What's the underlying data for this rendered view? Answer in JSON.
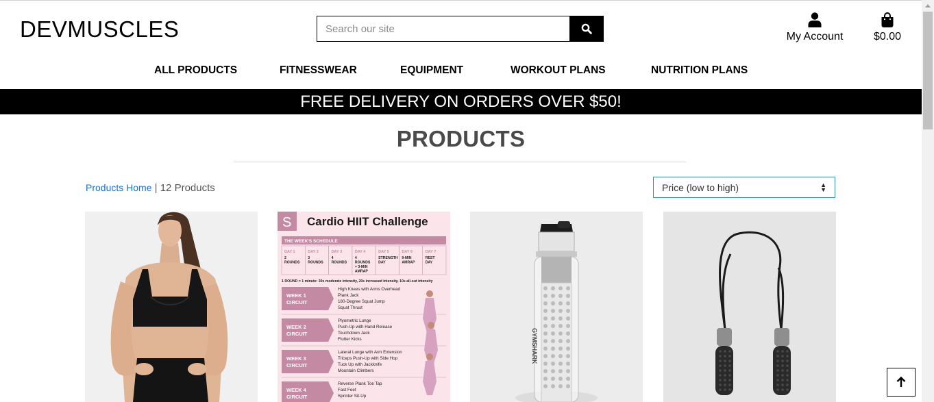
{
  "brand": {
    "logo": "DEVMUSCLES"
  },
  "search": {
    "placeholder": "Search our site",
    "value": "",
    "icon": "search-icon"
  },
  "account": {
    "label": "My Account",
    "icon": "user-icon"
  },
  "cart": {
    "total": "$0.00",
    "icon": "shopping-bag-icon"
  },
  "nav": {
    "items": [
      {
        "label": "ALL PRODUCTS"
      },
      {
        "label": "FITNESSWEAR"
      },
      {
        "label": "EQUIPMENT"
      },
      {
        "label": "WORKOUT PLANS"
      },
      {
        "label": "NUTRITION PLANS"
      }
    ]
  },
  "banner": {
    "text": "FREE DELIVERY ON ORDERS OVER $50!"
  },
  "page": {
    "title": "PRODUCTS"
  },
  "breadcrumb": {
    "home": "Products Home",
    "separator": " | ",
    "count": "12 Products"
  },
  "sort": {
    "selected": "Price (low to high)"
  },
  "products": [
    {
      "image": "black-sports-bra-photo"
    },
    {
      "image": "cardio-hiit-challenge-poster",
      "poster": {
        "badge": "S",
        "title": "Cardio HIIT Challenge",
        "schedule_label": "THE WEEK'S SCHEDULE",
        "days": [
          {
            "day": "DAY 1",
            "text": [
              "2",
              "ROUNDS"
            ]
          },
          {
            "day": "DAY 2",
            "text": [
              "3",
              "ROUNDS"
            ]
          },
          {
            "day": "DAY 3",
            "text": [
              "4",
              "ROUNDS"
            ]
          },
          {
            "day": "DAY 4",
            "text": [
              "4",
              "ROUNDS",
              "+ 3-MIN",
              "AMRAP"
            ]
          },
          {
            "day": "DAY 5",
            "text": [
              "STRENGTH",
              "DAY"
            ]
          },
          {
            "day": "DAY 6",
            "text": [
              "9-MIN",
              "AMRAP"
            ]
          },
          {
            "day": "DAY 7",
            "text": [
              "REST",
              "DAY"
            ]
          }
        ],
        "round_note": "1 ROUND = 1 minute: 30s moderate intensity, 20s increased intensity, 10s all-out intensity",
        "weeks": [
          {
            "label": [
              "WEEK 1",
              "CIRCUIT"
            ],
            "moves": [
              "High Knees with Arms Overhead",
              "Plank Jack",
              "180-Degree Squat Jump",
              "Squat Thrust"
            ]
          },
          {
            "label": [
              "WEEK 2",
              "CIRCUIT"
            ],
            "moves": [
              "Plyometric Lunge",
              "Push-Up with Hand Release",
              "Touchdown Jack",
              "Flutter Kicks"
            ]
          },
          {
            "label": [
              "WEEK 3",
              "CIRCUIT"
            ],
            "moves": [
              "Lateral Lunge with Arm Extension",
              "Triceps Push-Up with Side Hop",
              "Tuck Up with Jackknife",
              "Mountain Climbers"
            ]
          },
          {
            "label": [
              "WEEK 4",
              "CIRCUIT"
            ],
            "moves": [
              "Reverse Plank Toe Tap",
              "Fast Feet",
              "Sprinter Sit-Up"
            ]
          }
        ]
      }
    },
    {
      "image": "water-bottle-photo",
      "bottle_text": "GYMSHARK"
    },
    {
      "image": "skipping-rope-photo"
    }
  ],
  "back_to_top": {
    "icon": "arrow-up-icon"
  },
  "colors": {
    "accent_link": "#1a73c9",
    "sort_border": "#2b9ca7",
    "poster_pink": "#fbe4ea",
    "poster_mauve": "#c48aa4"
  }
}
